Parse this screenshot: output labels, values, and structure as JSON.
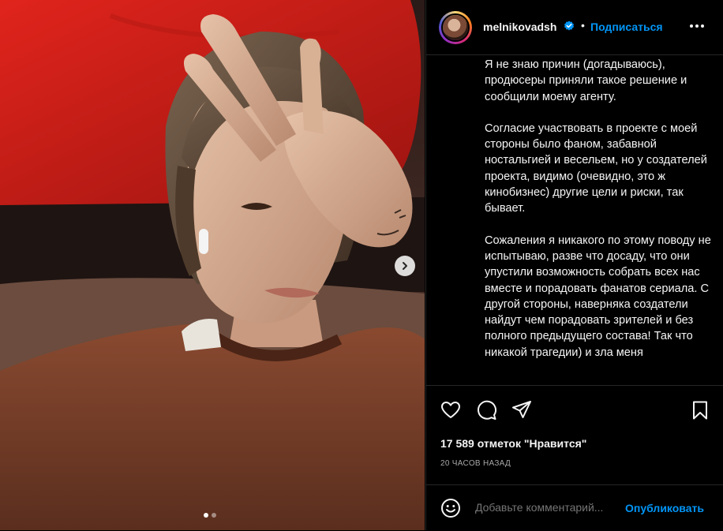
{
  "post": {
    "username": "melnikovadsh",
    "bullet": "•",
    "follow_label": "Подписаться",
    "caption_paragraphs": [
      "Я не знаю причин (догадываюсь), продюсеры приняли такое решение и сообщили моему агенту.",
      "Согласие участвовать в проекте с моей стороны было фаном, забавной ностальгией и весельем, но у создателей проекта, видимо (очевидно, это ж кинобизнес) другие цели и риски, так бывает.",
      "Сожаления я никакого по этому поводу не испытываю, разве что досаду, что они упустили возможность собрать всех нас вместе и порадовать фанатов сериала. С другой стороны, наверняка создатели найдут чем порадовать зрителей и без полного предыдущего состава! Так что никакой трагедии) и зла меня"
    ],
    "likes_text": "17 589 отметок \"Нравится\"",
    "time_text": "20 ЧАСОВ НАЗАД",
    "carousel": {
      "count": 2,
      "active_index": 0
    }
  },
  "comment": {
    "placeholder": "Добавьте комментарий...",
    "publish_label": "Опубликовать"
  },
  "colors": {
    "accent": "#0095f6",
    "background": "#000000",
    "text": "#f5f5f5",
    "muted": "#a8a8a8"
  },
  "icons": [
    "verified-badge-icon",
    "more-options-icon",
    "heart-icon",
    "comment-icon",
    "share-icon",
    "bookmark-icon",
    "emoji-icon",
    "chevron-right-icon"
  ]
}
